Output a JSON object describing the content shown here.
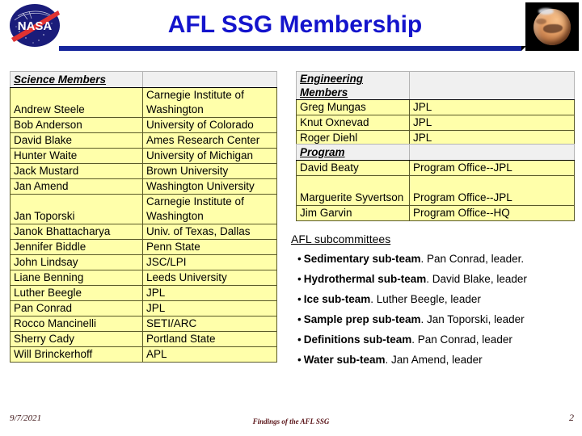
{
  "header": {
    "title": "AFL SSG Membership",
    "nasa_logo_text": "NASA",
    "mars_image_alt": "mars-globe",
    "title_color": "#1414cc",
    "rule_color": "#16259c"
  },
  "science_table": {
    "header": "Science Members",
    "header_blank": "",
    "rows": [
      {
        "name": "Andrew Steele",
        "affiliation": "Carnegie Institute of Washington",
        "tall": true
      },
      {
        "name": "Bob Anderson",
        "affiliation": "University of Colorado",
        "tall": false
      },
      {
        "name": "David Blake",
        "affiliation": "Ames Research Center",
        "tall": false
      },
      {
        "name": "Hunter Waite",
        "affiliation": "University of Michigan",
        "tall": false
      },
      {
        "name": "Jack Mustard",
        "affiliation": "Brown University",
        "tall": false
      },
      {
        "name": "Jan Amend",
        "affiliation": "Washington University",
        "tall": false
      },
      {
        "name": "Jan Toporski",
        "affiliation": "Carnegie Institute of Washington",
        "tall": true
      },
      {
        "name": "Janok Bhattacharya",
        "affiliation": "Univ. of Texas, Dallas",
        "tall": false
      },
      {
        "name": "Jennifer Biddle",
        "affiliation": "Penn State",
        "tall": false
      },
      {
        "name": "John Lindsay",
        "affiliation": "JSC/LPI",
        "tall": false
      },
      {
        "name": "Liane Benning",
        "affiliation": "Leeds University",
        "tall": false
      },
      {
        "name": "Luther Beegle",
        "affiliation": "JPL",
        "tall": false
      },
      {
        "name": "Pan Conrad",
        "affiliation": "JPL",
        "tall": false
      },
      {
        "name": "Rocco Mancinelli",
        "affiliation": "SETI/ARC",
        "tall": false
      },
      {
        "name": "Sherry Cady",
        "affiliation": "Portland State",
        "tall": false
      },
      {
        "name": "Will Brinckerhoff",
        "affiliation": "APL",
        "tall": false
      }
    ]
  },
  "engineering_table": {
    "header": "Engineering Members",
    "header_blank": "",
    "rows": [
      {
        "name": "Greg Mungas",
        "affiliation": "JPL",
        "tall": false
      },
      {
        "name": "Knut Oxnevad",
        "affiliation": "JPL",
        "tall": false
      },
      {
        "name": "Roger Diehl",
        "affiliation": "JPL",
        "tall": false
      }
    ]
  },
  "program_table": {
    "header": "Program",
    "header_blank": "",
    "rows": [
      {
        "name": "David Beaty",
        "affiliation": "Program Office--JPL",
        "tall": false
      },
      {
        "name": "Marguerite Syvertson",
        "affiliation": "Program Office--JPL",
        "tall": true
      },
      {
        "name": "Jim Garvin",
        "affiliation": "Program Office--HQ",
        "tall": false
      }
    ]
  },
  "subcommittees": {
    "heading": "AFL subcommittees",
    "bullet": "•",
    "items": [
      {
        "name": "Sedimentary sub-team",
        "leader": ".  Pan Conrad, leader."
      },
      {
        "name": "Hydrothermal sub-team",
        "leader": ".  David Blake, leader"
      },
      {
        "name": "Ice sub-team",
        "leader": ".  Luther Beegle, leader"
      },
      {
        "name": "Sample prep sub-team",
        "leader": ".  Jan Toporski, leader"
      },
      {
        "name": "Definitions sub-team",
        "leader": ".  Pan Conrad, leader"
      },
      {
        "name": "Water sub-team",
        "leader": ".  Jan Amend, leader"
      }
    ]
  },
  "footer": {
    "date": "9/7/2021",
    "center_text": "Findings of the AFL SSG",
    "page_number": "2"
  }
}
